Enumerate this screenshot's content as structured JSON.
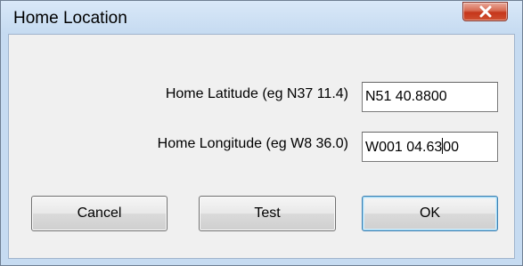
{
  "window": {
    "title": "Home Location",
    "close_label": "close"
  },
  "form": {
    "latitude_label": "Home Latitude (eg N37 11.4)",
    "latitude_value": "N51 40.8800",
    "longitude_label": "Home Longitude (eg W8 36.0)",
    "longitude_value_before_caret": "W001 04.63",
    "longitude_value_after_caret": "00"
  },
  "buttons": {
    "cancel": "Cancel",
    "test": "Test",
    "ok": "OK"
  },
  "icons": {
    "close": "close-icon"
  },
  "colors": {
    "frame": "#c6dbf1",
    "client": "#f0f0f0",
    "close_button": "#c5361b",
    "default_button_border": "#3c7fb1"
  }
}
